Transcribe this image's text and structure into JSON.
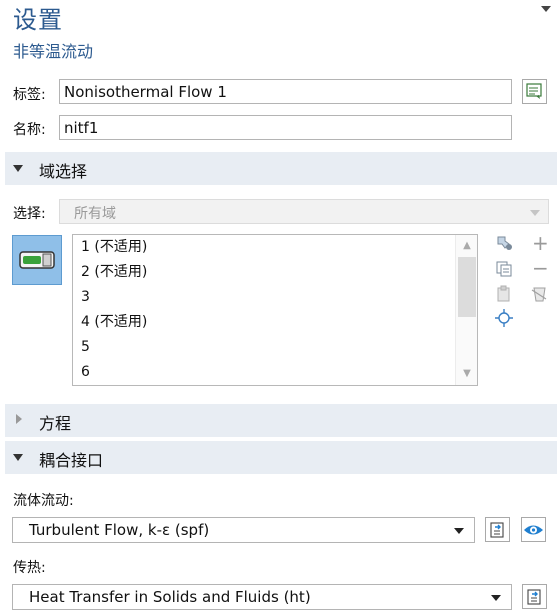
{
  "header": {
    "title": "设置",
    "subtitle": "非等温流动"
  },
  "fields": {
    "label_caption": "标签:",
    "label_value": "Nonisothermal Flow 1",
    "name_caption": "名称:",
    "name_value": "nitf1"
  },
  "domain_section": {
    "title": "域选择",
    "selection_caption": "选择:",
    "selection_value": "所有域",
    "items": [
      "1 (不适用)",
      "2 (不适用)",
      "3",
      "4 (不适用)",
      "5",
      "6"
    ]
  },
  "equation_section": {
    "title": "方程"
  },
  "coupling_section": {
    "title": "耦合接口",
    "fluid_caption": "流体流动:",
    "fluid_value": "Turbulent Flow, k-ε (spf)",
    "heat_caption": "传热:",
    "heat_value": "Heat Transfer in Solids and Fluids (ht)"
  },
  "colors": {
    "accent": "#2c5a8f",
    "section_bg": "#e8edf3",
    "toggle_bg": "#8fbfe8",
    "toggle_green": "#3aa23a",
    "eye_blue": "#1f7fd0"
  },
  "icons": [
    "chevron-down-icon",
    "label-edit-icon",
    "domain-toggle-icon",
    "add-icon",
    "remove-icon",
    "copy-icon",
    "paste-icon",
    "zoom-icon",
    "clear-icon",
    "goto-source-icon",
    "show-icon"
  ]
}
